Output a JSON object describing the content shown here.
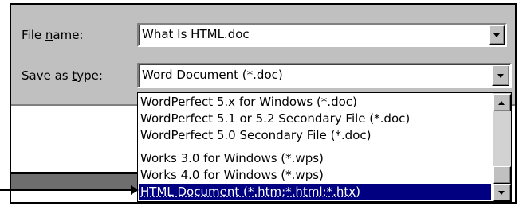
{
  "dialog": {
    "file_name_label": "File name:",
    "file_name_label_pre": "File ",
    "file_name_label_u": "n",
    "file_name_label_post": "ame:",
    "file_name_value": "What Is HTML.doc",
    "save_as_type_label_pre": "Save as ",
    "save_as_type_label_u": "t",
    "save_as_type_label_post": "ype:",
    "save_as_type_value": "Word Document (*.doc)"
  },
  "dropdown": {
    "options": [
      "WordPerfect 5.x for Windows (*.doc)",
      "WordPerfect 5.1 or 5.2 Secondary File (*.doc)",
      "WordPerfect 5.0 Secondary File (*.doc)",
      "Works 3.0 for Windows (*.wps)",
      "Works 4.0 for Windows (*.wps)",
      "HTML Document (*.htm;*.html;*.htx)"
    ],
    "selected_index": 5
  },
  "icons": {
    "combo_arrow": "chevron-down-icon",
    "scroll_up": "scroll-up-icon",
    "scroll_down": "scroll-down-icon",
    "callout": "callout-arrow-icon"
  },
  "colors": {
    "selection": "#000080",
    "dialog_face": "#c0c0c0"
  }
}
